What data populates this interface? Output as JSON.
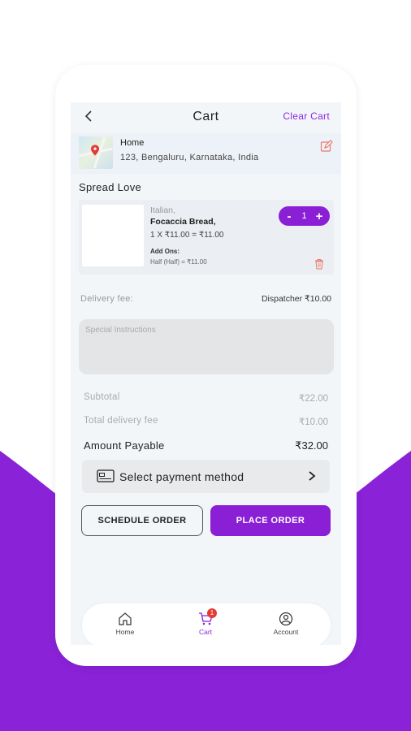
{
  "header": {
    "title": "Cart",
    "clear_label": "Clear Cart"
  },
  "address": {
    "title": "Home",
    "line": "123,  Bengaluru, Karnataka, India"
  },
  "store": {
    "name": "Spread Love"
  },
  "item": {
    "category": "Italian,",
    "name": "Focaccia Bread,",
    "price_line": "1 X ₹11.00 = ₹11.00",
    "addons_label": "Add Ons:",
    "addon": "Half (Half) = ₹11.00",
    "quantity": "1",
    "minus": "-",
    "plus": "+"
  },
  "delivery": {
    "label": "Delivery fee:",
    "value": "Dispatcher  ₹10.00"
  },
  "instructions": {
    "placeholder": "Special Instructions"
  },
  "summary": {
    "subtotal_label": "Subtotal",
    "subtotal_value": "₹22.00",
    "delivery_label": "Total delivery fee",
    "delivery_value": "₹10.00",
    "payable_label": "Amount Payable",
    "payable_value": "₹32.00"
  },
  "payment": {
    "label": "Select payment method"
  },
  "buttons": {
    "schedule": "SCHEDULE ORDER",
    "place": "PLACE ORDER"
  },
  "nav": {
    "home": "Home",
    "cart": "Cart",
    "account": "Account",
    "cart_badge": "1"
  },
  "colors": {
    "accent": "#8a1fd6",
    "screen_bg": "#f3f6f9",
    "badge": "#e53935"
  }
}
